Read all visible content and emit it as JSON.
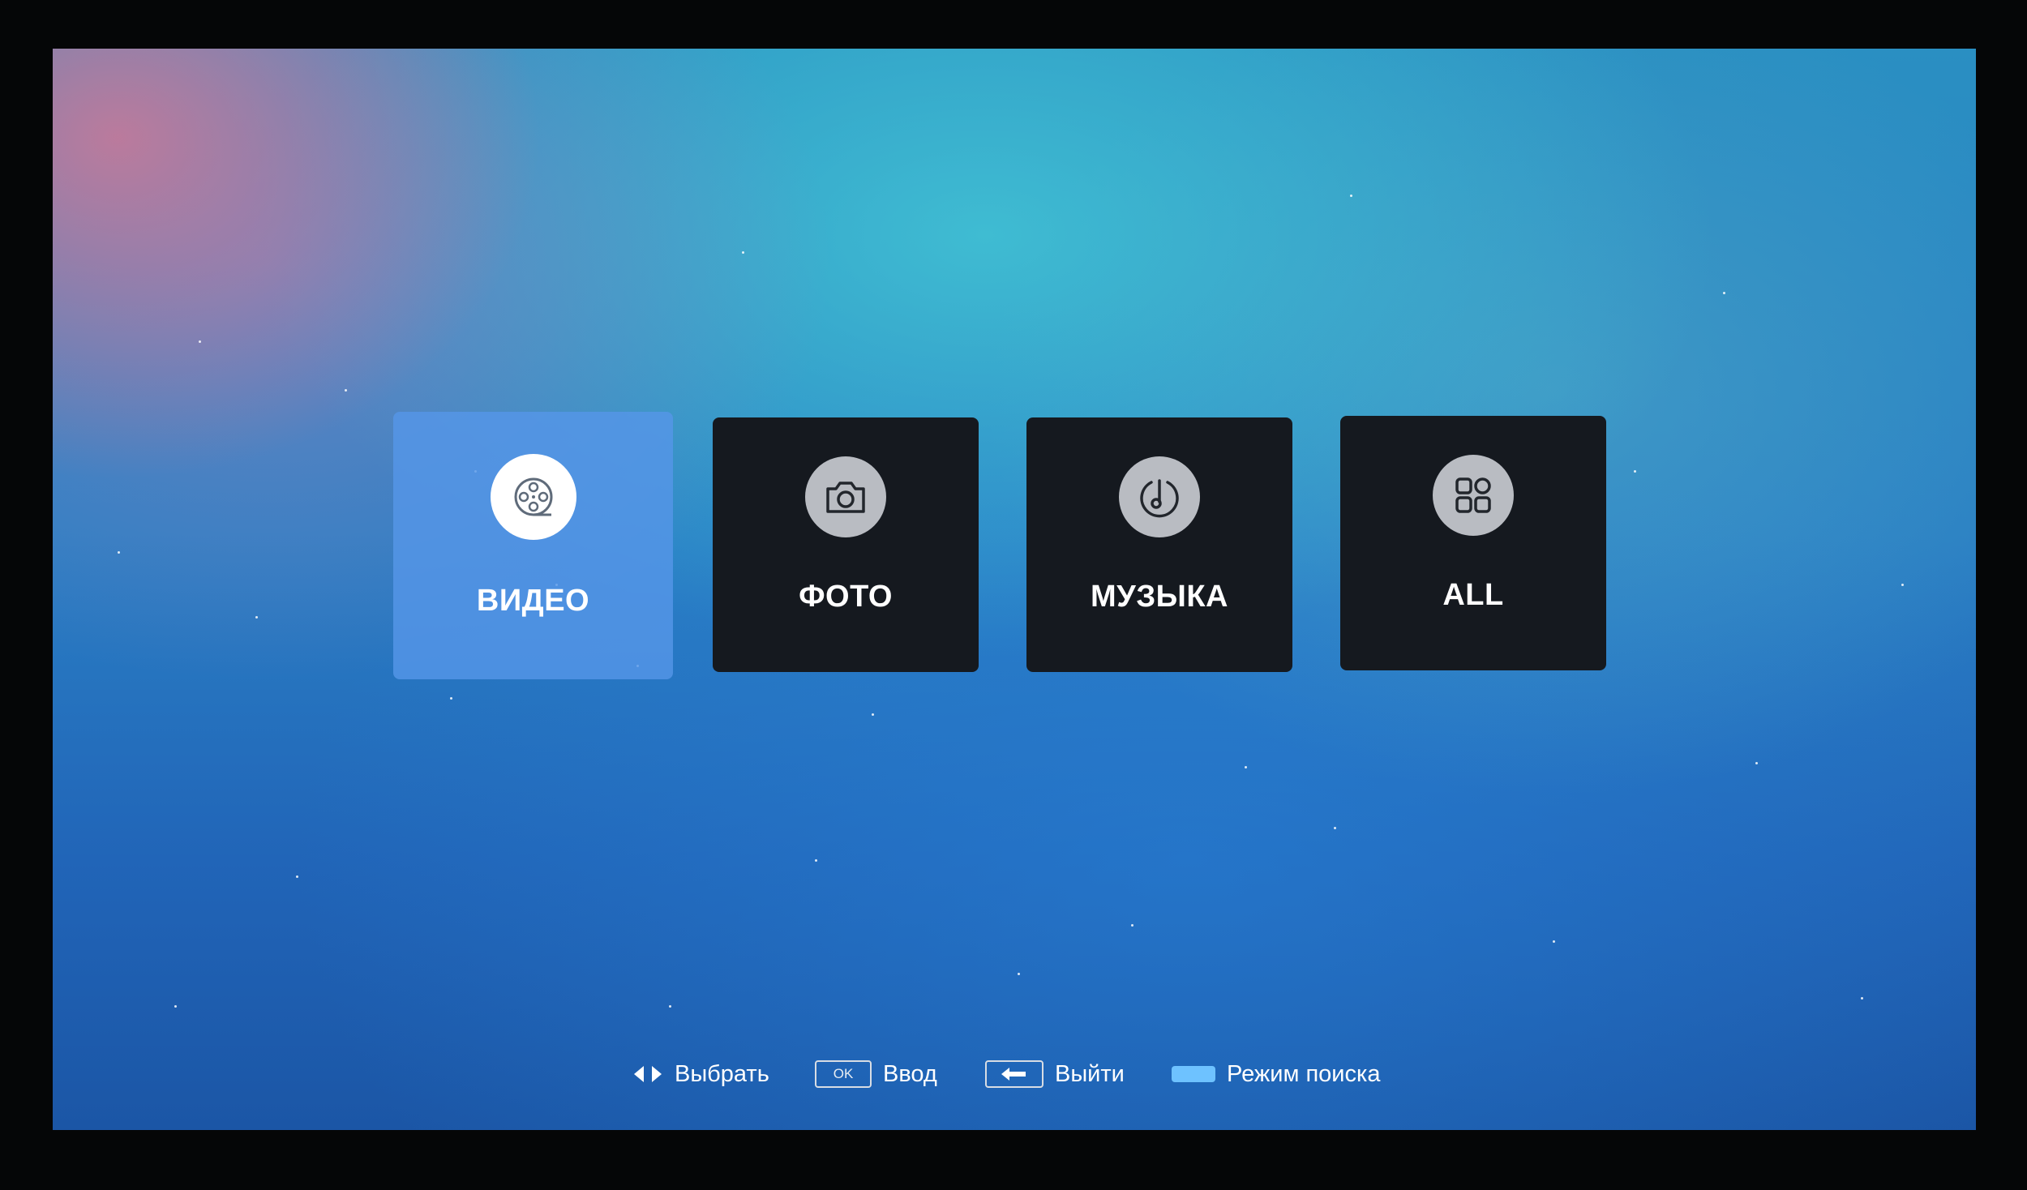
{
  "tiles": [
    {
      "label": "ВИДЕО",
      "icon": "film-reel-icon",
      "selected": true
    },
    {
      "label": "ФОТО",
      "icon": "camera-icon",
      "selected": false
    },
    {
      "label": "МУЗЫКА",
      "icon": "music-note-icon",
      "selected": false
    },
    {
      "label": "ALL",
      "icon": "grid-apps-icon",
      "selected": false
    }
  ],
  "hints": {
    "select_label": "Выбрать",
    "ok_key": "OK",
    "enter_label": "Ввод",
    "exit_label": "Выйти",
    "search_label": "Режим поиска"
  },
  "colors": {
    "active_tile": "#5696E8",
    "inactive_tile": "#15191F",
    "search_key": "#6EC2FF"
  }
}
